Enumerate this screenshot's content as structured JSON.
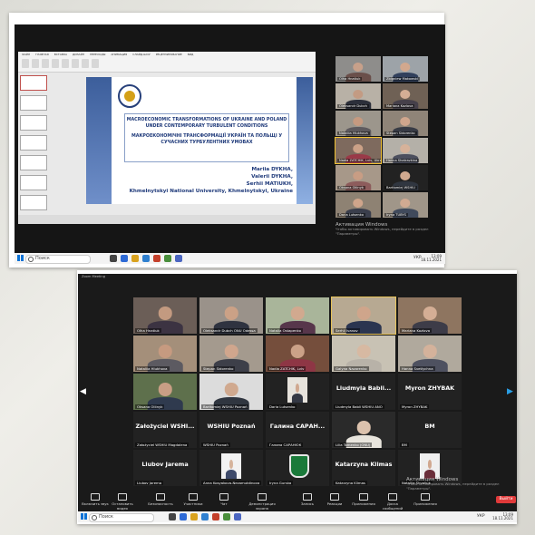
{
  "top_window": {
    "ppt": {
      "ribbon_tabs": [
        "ФАЙЛ",
        "ГЛАВНАЯ",
        "ВСТАВКА",
        "ДИЗАЙН",
        "ПЕРЕХОДЫ",
        "АНИМАЦИЯ",
        "СЛАЙД-ШОУ",
        "РЕЦЕНЗИРОВАНИЕ",
        "ВИД"
      ],
      "slide_title_en": "MACROECONOMIC TRANSFORMATIONS OF UKRAINE AND POLAND UNDER CONTEMPORARY TURBULENT CONDITIONS",
      "slide_title_ua": "МАКРОЕКОНОМІЧНІ ТРАНСФОРМАЦІЇ УКРАЇН ТА ПОЛЬЩІ У СУЧАСНИХ ТУРБУЛЕНТНИХ УМОВАХ",
      "authors": [
        "Mariia DYKHA,",
        "Valerii DYKHA,",
        "Serhii MATIUKH,",
        "Khmelnytskyi National University, Khmelnytskyi, Ukraine"
      ]
    },
    "gallery": [
      {
        "name": "Olha Hnatiuk",
        "skin": "#c7a08a",
        "shirt": "#6a4f4a",
        "bg": "#8e8d8b"
      },
      {
        "name": "Zbigniew Makowski",
        "skin": "#d2a88e",
        "shirt": "#31405c",
        "bg": "#9da3a8"
      },
      {
        "name": "Oleksandr Dubch",
        "skin": "#c39b83",
        "shirt": "#2c2f3a",
        "bg": "#b8b1a6"
      },
      {
        "name": "Mariana Kozlova",
        "skin": "#d4ae95",
        "shirt": "#46404a",
        "bg": "#6f6155"
      },
      {
        "name": "Nataliia Hlukhova",
        "skin": "#c69a80",
        "shirt": "#5e5a5e",
        "bg": "#9c968c"
      },
      {
        "name": "Stepan Sidorenko",
        "skin": "#d0a68d",
        "shirt": "#383b45",
        "bg": "#8f8478"
      },
      {
        "name": "Nadia ZATCHIK, Lviv, Ukraine",
        "skin": "#cba187",
        "shirt": "#9a3a48",
        "bg": "#7e6a5e"
      },
      {
        "name": "Hanna Shatravkina",
        "skin": "#d6b29a",
        "shirt": "#4c4f5e",
        "bg": "#b4b0a8"
      },
      {
        "name": "Oksana Oliinyk",
        "skin": "#c89d84",
        "shirt": "#8d5c5c",
        "bg": "#a79889"
      },
      {
        "name": "Bartłomiej WSHIU",
        "skin": "#d0a98f",
        "shirt": "#303640",
        "bg": "#222"
      },
      {
        "name": "Daria Lutsenko",
        "skin": "#cfa58b",
        "shirt": "#3a3e4c",
        "bg": "#8e8273"
      },
      {
        "name": "Iryna TUBYS",
        "skin": "#d1aa92",
        "shirt": "#404a5c",
        "bg": "#a09689"
      }
    ],
    "activate_title": "Активация Windows",
    "activate_sub": "Чтобы активировать Windows, перейдите в раздел \"Параметры\".",
    "taskbar": {
      "search": "Поиск",
      "lang": "УКР",
      "time": "13:09",
      "date": "18.11.2021"
    }
  },
  "bottom_window": {
    "title": "Zoom Meeting",
    "tiles": [
      {
        "type": "video",
        "name": "Olha Hnatiuk",
        "skin": "#c39a80",
        "shirt": "#3c3342",
        "bg": "#6b5e57"
      },
      {
        "type": "video",
        "name": "Oleksandr Dubch ONU Odessa",
        "skin": "#cba186",
        "shirt": "#2f3340",
        "bg": "#9a928a"
      },
      {
        "type": "video",
        "name": "Natalia Ostapenko",
        "skin": "#d1a98f",
        "shirt": "#57364b",
        "bg": "#a9b59a"
      },
      {
        "type": "video",
        "name": "Serhii Ivanov",
        "skin": "#cfa58b",
        "shirt": "#2b3550",
        "bg": "#b7a992",
        "hl": true
      },
      {
        "type": "video",
        "name": "Mariana Kozlova",
        "skin": "#d4ae95",
        "shirt": "#3d3c48",
        "bg": "#8e7560"
      },
      {
        "type": "video",
        "name": "Nataliia Hlukhova",
        "skin": "#c69a80",
        "shirt": "#5c5a61",
        "bg": "#a48f7a"
      },
      {
        "type": "video",
        "name": "Stepan Sidorenko",
        "skin": "#d0a68d",
        "shirt": "#3d3f49",
        "bg": "#a49a8e"
      },
      {
        "type": "video",
        "name": "Nadia ZATCHIK, Lviv",
        "skin": "#cba187",
        "shirt": "#8e3645",
        "bg": "#754e3c"
      },
      {
        "type": "video",
        "name": "Galyna Nazarenko",
        "skin": "#d7b9a2",
        "shirt": "#b8b2a8",
        "bg": "#c8c2b4"
      },
      {
        "type": "video",
        "name": "Hanna Svetlychna",
        "skin": "#d4b29b",
        "shirt": "#4e5160",
        "bg": "#b0a99d"
      },
      {
        "type": "video",
        "name": "Oksana Oliinyk",
        "skin": "#c99e85",
        "shirt": "#2f3a4e",
        "bg": "#5e704c"
      },
      {
        "type": "video",
        "name": "Bartłomiej WSHIU Poznań",
        "skin": "#d0a98f",
        "shirt": "#303640",
        "bg": "#dcdcdc"
      },
      {
        "type": "video",
        "name": "Daria Lutsenko",
        "skin": "#d0a88f",
        "shirt": "#343844",
        "bg": "#e7e3dc"
      },
      {
        "type": "text",
        "big": "Liudmyla Babli...",
        "name": "Liudmyla Babli WSHIU ANO"
      },
      {
        "type": "text",
        "big": "Myron ZHYBAK",
        "name": "Myron ZHYBAK"
      },
      {
        "type": "text",
        "big": "Założyciel WSHI...",
        "name": "Założyciel WSHIU Magdalena"
      },
      {
        "type": "text",
        "big": "WSHIU Poznań",
        "name": "WSHIU Poznań"
      },
      {
        "type": "text",
        "big": "Галина САРАН...",
        "name": "Галина САРАНЮК"
      },
      {
        "type": "video",
        "name": "Lilia Tomenko (ONU)",
        "skin": "#dcc2ad",
        "shirt": "#e8e4dc",
        "bg": "#2a2a2a"
      },
      {
        "type": "text",
        "big": "BM",
        "name": "BM"
      },
      {
        "type": "text",
        "big": "Liubov Jarema",
        "name": "Liubov Jarema"
      },
      {
        "type": "video",
        "name": "Anna Kosyakova-Nezamutdinova",
        "skin": "#d6b49c",
        "shirt": "#3e4a6a",
        "bg": "#f2f2f2"
      },
      {
        "type": "logo",
        "name": "Iryna Gurska"
      },
      {
        "type": "text",
        "big": "Katarzyna Klimas",
        "name": "Katarzyna Klimas"
      },
      {
        "type": "video",
        "name": "Nataliia Shvaliuk",
        "skin": "#d1a88f",
        "shirt": "#6a2e3a",
        "bg": "#efefef"
      }
    ],
    "controls": [
      "Включить звук",
      "Остановить видео",
      "Безопасность",
      "Участники",
      "Чат",
      "Демонстрация экрана",
      "Запись",
      "Реакции",
      "Приложения",
      "Доска сообщений",
      "Приложения"
    ],
    "end_label": "Выйти",
    "activate_title": "Активация Windows",
    "activate_sub": "Чтобы активировать Windows, перейдите в раздел \"Параметры\".",
    "taskbar": {
      "search": "Поиск",
      "lang": "УКР",
      "time": "13:09",
      "date": "18.11.2021"
    }
  },
  "icons": {
    "search": "search-icon",
    "windows": "windows-icon",
    "next": "chevron-right-icon",
    "prev": "chevron-left-icon"
  },
  "colors": {
    "accent_blue": "#1f3a7a",
    "end_red": "#e03a3a",
    "highlight": "#e8c45a"
  }
}
